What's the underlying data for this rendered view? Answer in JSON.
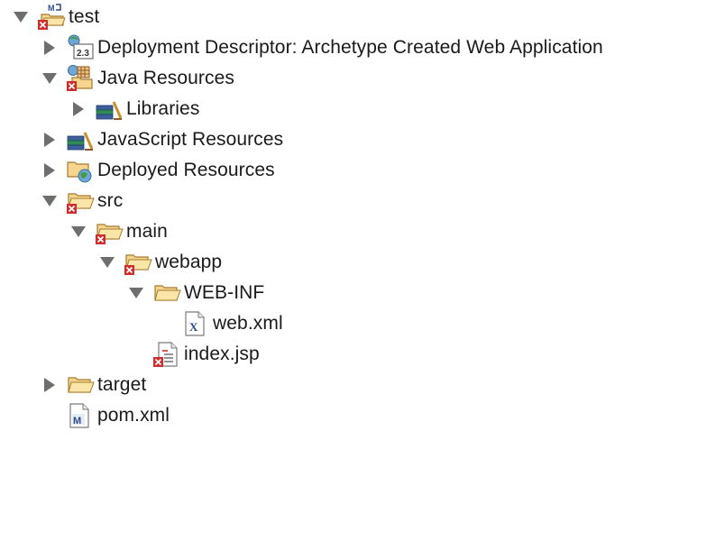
{
  "tree": {
    "items": [
      {
        "label": "test",
        "icon": "maven-project-icon",
        "expanded": true,
        "error": true
      },
      {
        "label": "Deployment Descriptor: Archetype Created Web Application",
        "icon": "deployment-descriptor-icon",
        "expanded": false,
        "error": false
      },
      {
        "label": "Java Resources",
        "icon": "java-resources-icon",
        "expanded": true,
        "error": true
      },
      {
        "label": "Libraries",
        "icon": "libraries-icon",
        "expanded": false,
        "error": false
      },
      {
        "label": "JavaScript Resources",
        "icon": "javascript-resources-icon",
        "expanded": false,
        "error": false
      },
      {
        "label": "Deployed Resources",
        "icon": "deployed-resources-icon",
        "expanded": false,
        "error": false
      },
      {
        "label": "src",
        "icon": "folder-icon",
        "expanded": true,
        "error": true
      },
      {
        "label": "main",
        "icon": "folder-icon",
        "expanded": true,
        "error": true
      },
      {
        "label": "webapp",
        "icon": "folder-icon",
        "expanded": true,
        "error": true
      },
      {
        "label": "WEB-INF",
        "icon": "folder-icon",
        "expanded": true,
        "error": false
      },
      {
        "label": "web.xml",
        "icon": "xml-file-icon",
        "expanded": null,
        "error": false
      },
      {
        "label": "index.jsp",
        "icon": "jsp-file-icon",
        "expanded": null,
        "error": true
      },
      {
        "label": "target",
        "icon": "folder-icon",
        "expanded": false,
        "error": false
      },
      {
        "label": "pom.xml",
        "icon": "maven-pom-icon",
        "expanded": null,
        "error": false
      }
    ]
  },
  "colors": {
    "twisty": "#6e6e6e",
    "folder_fill": "#f6d58f",
    "folder_stroke": "#a77a2c",
    "error_red": "#d12b2b"
  }
}
